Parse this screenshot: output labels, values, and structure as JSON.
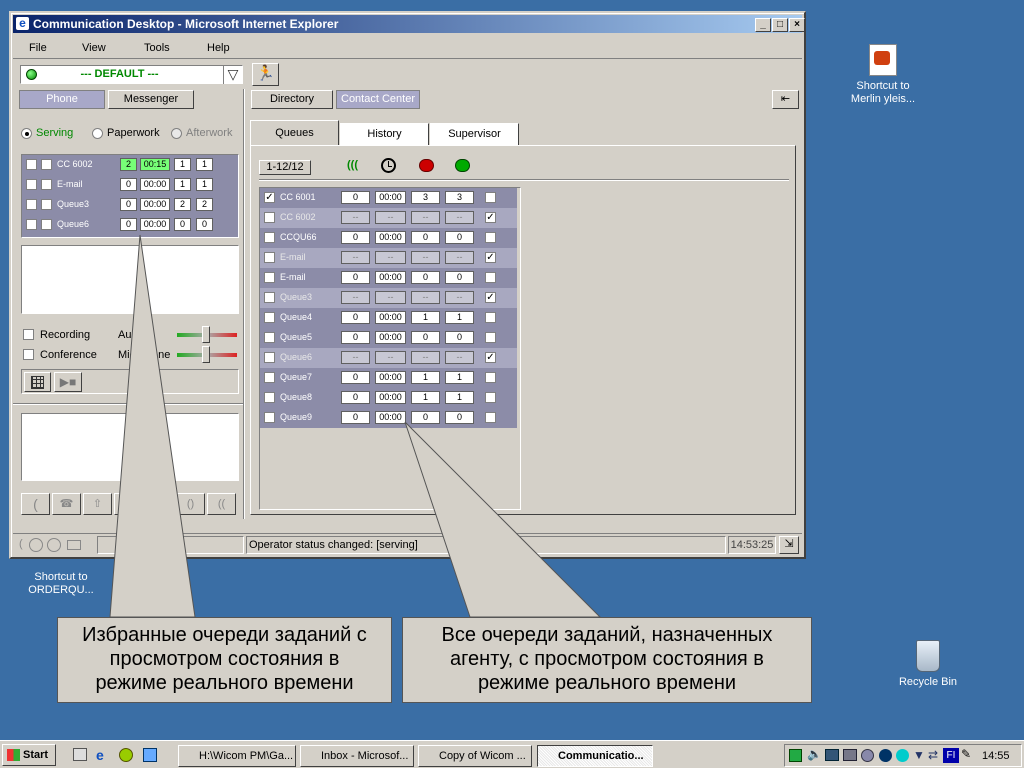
{
  "window": {
    "title": "Communication Desktop - Microsoft Internet Explorer",
    "menu": [
      "File",
      "View",
      "Tools",
      "Help"
    ],
    "profile": "--- DEFAULT ---"
  },
  "left_tabs": [
    "Phone",
    "Messenger"
  ],
  "right_tabs": [
    "Directory",
    "Contact Center"
  ],
  "status_options": [
    "Serving",
    "Paperwork",
    "Afterwork"
  ],
  "favorites": [
    {
      "name": "CC 6002",
      "c1": "2",
      "c2": "00:15",
      "c3": "1",
      "c4": "1"
    },
    {
      "name": "E-mail",
      "c1": "0",
      "c2": "00:00",
      "c3": "1",
      "c4": "1"
    },
    {
      "name": "Queue3",
      "c1": "0",
      "c2": "00:00",
      "c3": "2",
      "c4": "2"
    },
    {
      "name": "Queue6",
      "c1": "0",
      "c2": "00:00",
      "c3": "0",
      "c4": "0"
    }
  ],
  "audio": {
    "recording": "Recording",
    "conference": "Conference",
    "audio_label": "Au",
    "mic_label": "Mic",
    "mic_tail": "one"
  },
  "sub_tabs": [
    "Queues",
    "History",
    "Supervisor"
  ],
  "range": "1-12/12",
  "queues": [
    {
      "name": "CC 6001",
      "c1": "0",
      "c2": "00:00",
      "c3": "3",
      "c4": "3",
      "checked": true,
      "dim": false,
      "right": false
    },
    {
      "name": "CC 6002",
      "c1": "--",
      "c2": "--",
      "c3": "--",
      "c4": "--",
      "checked": false,
      "dim": true,
      "right": true
    },
    {
      "name": "CCQU66",
      "c1": "0",
      "c2": "00:00",
      "c3": "0",
      "c4": "0",
      "checked": false,
      "dim": false,
      "right": false
    },
    {
      "name": "E-mail",
      "c1": "--",
      "c2": "--",
      "c3": "--",
      "c4": "--",
      "checked": false,
      "dim": true,
      "right": true
    },
    {
      "name": "E-mail",
      "c1": "0",
      "c2": "00:00",
      "c3": "0",
      "c4": "0",
      "checked": false,
      "dim": false,
      "right": false
    },
    {
      "name": "Queue3",
      "c1": "--",
      "c2": "--",
      "c3": "--",
      "c4": "--",
      "checked": false,
      "dim": true,
      "right": true
    },
    {
      "name": "Queue4",
      "c1": "0",
      "c2": "00:00",
      "c3": "1",
      "c4": "1",
      "checked": false,
      "dim": false,
      "right": false
    },
    {
      "name": "Queue5",
      "c1": "0",
      "c2": "00:00",
      "c3": "0",
      "c4": "0",
      "checked": false,
      "dim": false,
      "right": false
    },
    {
      "name": "Queue6",
      "c1": "--",
      "c2": "--",
      "c3": "--",
      "c4": "--",
      "checked": false,
      "dim": true,
      "right": true
    },
    {
      "name": "Queue7",
      "c1": "0",
      "c2": "00:00",
      "c3": "1",
      "c4": "1",
      "checked": false,
      "dim": false,
      "right": false
    },
    {
      "name": "Queue8",
      "c1": "0",
      "c2": "00:00",
      "c3": "1",
      "c4": "1",
      "checked": false,
      "dim": false,
      "right": false
    },
    {
      "name": "Queue9",
      "c1": "0",
      "c2": "00:00",
      "c3": "0",
      "c4": "0",
      "checked": false,
      "dim": false,
      "right": false
    }
  ],
  "statusbar": {
    "message": "Operator status changed: [serving]",
    "time": "14:53:25"
  },
  "callouts": {
    "left": "Избранные очереди заданий с просмотром состояния в режиме реального времени",
    "right": "Все очереди заданий, назначенных агенту, с просмотром состояния в режиме реального времени"
  },
  "desktop": {
    "shortcut1": "Shortcut to Merlin yleis...",
    "shortcut2": "Shortcut to ORDERQU...",
    "recycle": "Recycle Bin"
  },
  "taskbar": {
    "start": "Start",
    "tasks": [
      "H:\\Wicom PM\\Ga...",
      "Inbox - Microsof...",
      "Copy of Wicom ...",
      "Communicatio..."
    ],
    "lang": "FI",
    "clock": "14:55"
  },
  "colors": {
    "desktop": "#3a6ea5",
    "title_start": "#0a246a",
    "title_end": "#a6caf0",
    "queue_row": "#8c8ca8",
    "callout": "#d4d0c8"
  }
}
